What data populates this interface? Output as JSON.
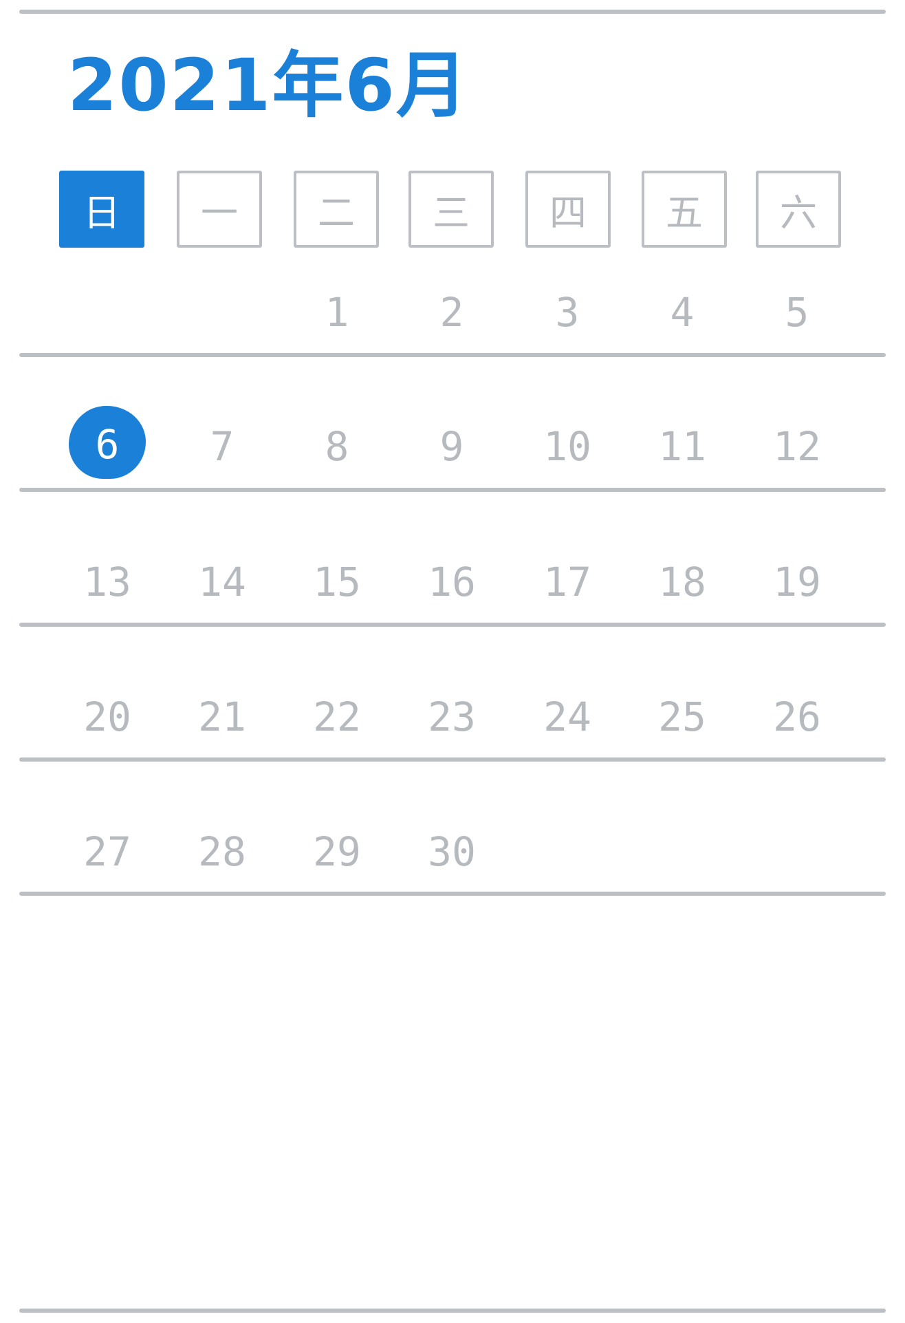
{
  "calendar": {
    "title": "2021年6月",
    "accent_color": "#1a80d8",
    "muted_color": "#b6babe",
    "weekdays": [
      {
        "label": "日",
        "active": true
      },
      {
        "label": "一",
        "active": false
      },
      {
        "label": "二",
        "active": false
      },
      {
        "label": "三",
        "active": false
      },
      {
        "label": "四",
        "active": false
      },
      {
        "label": "五",
        "active": false
      },
      {
        "label": "六",
        "active": false
      }
    ],
    "weeks": [
      [
        "",
        "",
        "1",
        "2",
        "3",
        "4",
        "5"
      ],
      [
        "6",
        "7",
        "8",
        "9",
        "10",
        "11",
        "12"
      ],
      [
        "13",
        "14",
        "15",
        "16",
        "17",
        "18",
        "19"
      ],
      [
        "20",
        "21",
        "22",
        "23",
        "24",
        "25",
        "26"
      ],
      [
        "27",
        "28",
        "29",
        "30",
        "",
        "",
        ""
      ]
    ],
    "today": "6"
  }
}
